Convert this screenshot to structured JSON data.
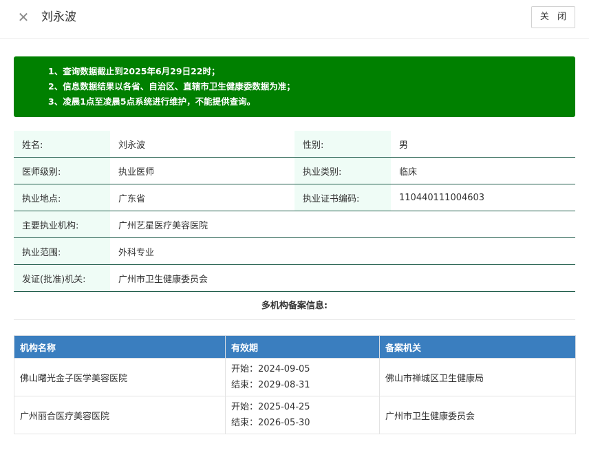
{
  "header": {
    "close_icon": "close-icon",
    "title": "刘永波",
    "close_button_label": "关 闭"
  },
  "notice": {
    "lines": [
      "1、查询数据截止到2025年6月29日22时；",
      "2、信息数据结果以各省、自治区、直辖市卫生健康委数据为准；",
      "3、凌晨1点至凌晨5点系统进行维护，不能提供查询。"
    ],
    "background_color": "#008000"
  },
  "info": {
    "rows": [
      [
        {
          "label": "姓名:",
          "value": "刘永波"
        },
        {
          "label": "性别:",
          "value": "男"
        }
      ],
      [
        {
          "label": "医师级别:",
          "value": "执业医师"
        },
        {
          "label": "执业类别:",
          "value": "临床"
        }
      ],
      [
        {
          "label": "执业地点:",
          "value": "广东省"
        },
        {
          "label": "执业证书编码:",
          "value": "110440111004603"
        }
      ],
      [
        {
          "label": "主要执业机构:",
          "value": "广州艺星医疗美容医院"
        }
      ],
      [
        {
          "label": "执业范围:",
          "value": "外科专业"
        }
      ],
      [
        {
          "label": "发证(批准)机关:",
          "value": "广州市卫生健康委员会"
        }
      ]
    ]
  },
  "records": {
    "title": "多机构备案信息:",
    "headers": [
      "机构名称",
      "有效期",
      "备案机关"
    ],
    "header_color": "#3a7ebf",
    "rows": [
      {
        "org": "佛山曙光金子医学美容医院",
        "start": "开始：2024-09-05",
        "end": "结束：2029-08-31",
        "authority": "佛山市禅城区卫生健康局"
      },
      {
        "org": "广州丽合医疗美容医院",
        "start": "开始：2025-04-25",
        "end": "结束：2026-05-30",
        "authority": "广州市卫生健康委员会"
      }
    ]
  }
}
